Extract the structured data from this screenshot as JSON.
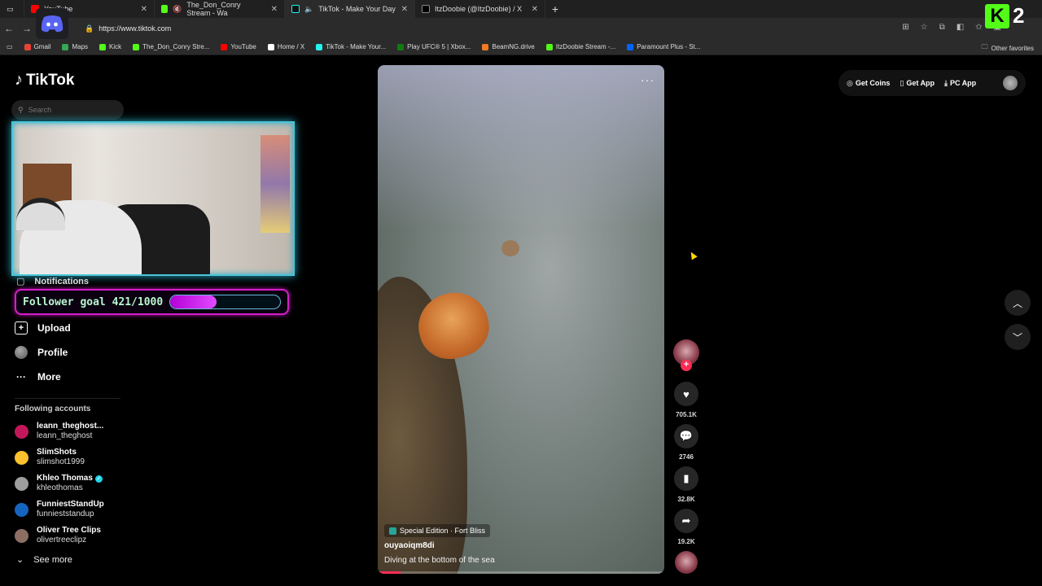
{
  "browser": {
    "tabs": [
      {
        "title": "YouTube",
        "fav_color": "#ff0000"
      },
      {
        "title": "The_Don_Conry Stream - Wa",
        "fav_color": "#53fc18"
      },
      {
        "title": "TikTok - Make Your Day",
        "fav_color": "#111111"
      },
      {
        "title": "ItzDoobie (@ItzDoobie) / X",
        "fav_color": "#000000"
      }
    ],
    "url": "https://www.tiktok.com",
    "bookmarks": [
      {
        "label": "Gmail",
        "color": "#ea4335"
      },
      {
        "label": "Maps",
        "color": "#34a853"
      },
      {
        "label": "Kick",
        "color": "#53fc18"
      },
      {
        "label": "The_Don_Conry Stre...",
        "color": "#53fc18"
      },
      {
        "label": "YouTube",
        "color": "#ff0000"
      },
      {
        "label": "Home / X",
        "color": "#ffffff"
      },
      {
        "label": "TikTok - Make Your...",
        "color": "#25f4ee"
      },
      {
        "label": "Play UFC® 5 | Xbox...",
        "color": "#107c10"
      },
      {
        "label": "BeamNG.drive",
        "color": "#f47920"
      },
      {
        "label": "ItzDoobie Stream -...",
        "color": "#53fc18"
      },
      {
        "label": "Paramount Plus - St...",
        "color": "#0064ff"
      }
    ],
    "other_favorites": "Other favorites"
  },
  "kick_badge": {
    "count": "2"
  },
  "tiktok": {
    "logo": "TikTok",
    "search_placeholder": "Search",
    "notifications_label": "Notifications",
    "follower_goal": {
      "text": "Follower goal 421/1000",
      "current": 421,
      "target": 1000
    },
    "menu": [
      {
        "label": "Upload"
      },
      {
        "label": "Profile"
      },
      {
        "label": "More"
      }
    ],
    "following_header": "Following accounts",
    "following": [
      {
        "name": "leann_theghost...",
        "handle": "leann_theghost",
        "color": "#c2185b",
        "verified": false
      },
      {
        "name": "SlimShots",
        "handle": "slimshot1999",
        "color": "#fbc02d",
        "verified": false
      },
      {
        "name": "Khleo Thomas",
        "handle": "khleothomas",
        "color": "#9e9e9e",
        "verified": true
      },
      {
        "name": "FunniestStandUp",
        "handle": "funnieststandup",
        "color": "#1565c0",
        "verified": false
      },
      {
        "name": "Oliver Tree Clips",
        "handle": "olivertreeclipz",
        "color": "#8d6e63",
        "verified": false
      }
    ],
    "see_more": "See more",
    "top_buttons": {
      "coins": "Get Coins",
      "app": "Get App",
      "pc": "PC App"
    },
    "video": {
      "tag": "Special Edition · Fort Bliss",
      "username": "ouyaoiqm8di",
      "description": "Diving at the bottom of the sea",
      "progress_fraction": 0.08
    },
    "stats": {
      "likes": "705.1K",
      "comments": "2746",
      "saves": "32.8K",
      "shares": "19.2K"
    }
  }
}
